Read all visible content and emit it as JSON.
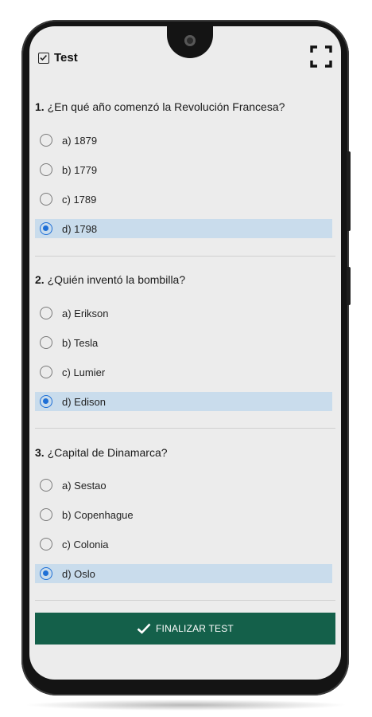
{
  "app": {
    "title": "Test"
  },
  "questions": [
    {
      "number": "1.",
      "text": "¿En qué año comenzó la Revolución Francesa?",
      "options": [
        "a) 1879",
        "b) 1779",
        "c) 1789",
        "d) 1798"
      ],
      "selected": 3
    },
    {
      "number": "2.",
      "text": " ¿Quién inventó la bombilla?",
      "options": [
        "a) Erikson",
        "b) Tesla",
        "c) Lumier",
        "d) Edison"
      ],
      "selected": 3
    },
    {
      "number": "3.",
      "text": "¿Capital de Dinamarca?",
      "options": [
        "a) Sestao",
        "b) Copenhague",
        "c) Colonia",
        "d) Oslo"
      ],
      "selected": 3
    }
  ],
  "finish_button": {
    "label": "FINALIZAR TEST"
  },
  "colors": {
    "accent": "#14604a",
    "radio_selected": "#1e6fd6",
    "selected_row": "#c9dcec"
  },
  "icons": {
    "app": "checkbox-icon",
    "fullscreen": "fullscreen-icon",
    "finish": "check-icon"
  }
}
